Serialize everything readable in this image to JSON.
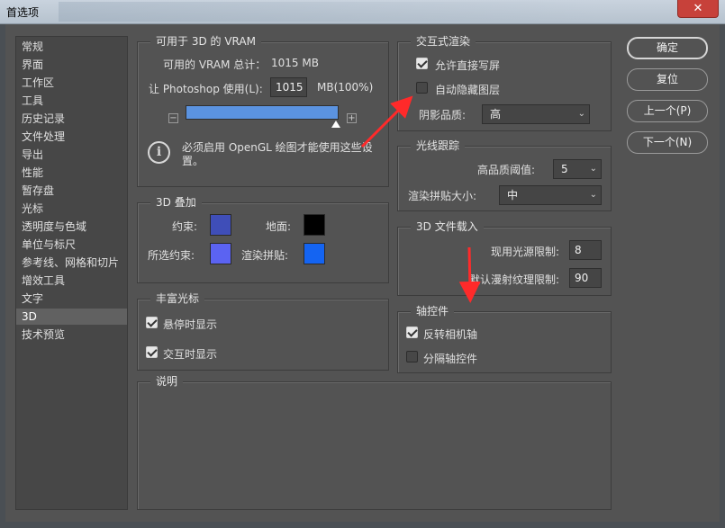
{
  "window": {
    "title": "首选项",
    "close_glyph": "✕"
  },
  "sidebar": {
    "items": [
      {
        "label": "常规"
      },
      {
        "label": "界面"
      },
      {
        "label": "工作区"
      },
      {
        "label": "工具"
      },
      {
        "label": "历史记录"
      },
      {
        "label": "文件处理"
      },
      {
        "label": "导出"
      },
      {
        "label": "性能"
      },
      {
        "label": "暂存盘"
      },
      {
        "label": "光标"
      },
      {
        "label": "透明度与色域"
      },
      {
        "label": "单位与标尺"
      },
      {
        "label": "参考线、网格和切片"
      },
      {
        "label": "增效工具"
      },
      {
        "label": "文字"
      },
      {
        "label": "3D"
      },
      {
        "label": "技术预览"
      }
    ],
    "active_index": 15
  },
  "vram": {
    "title": "可用于 3D 的 VRAM",
    "total_label": "可用的 VRAM 总计：",
    "total_value": "1015 MB",
    "use_label": "让 Photoshop 使用(L):",
    "use_value": "1015",
    "use_suffix": "MB(100%)",
    "slider_fraction": 1.0,
    "minus_icon": "minus-icon",
    "plus_icon": "plus-icon",
    "minus_glyph": "−",
    "plus_glyph": "+",
    "info_glyph": "i",
    "note": "必须启用 OpenGL 绘图才能使用这些设置。"
  },
  "overlay": {
    "title": "3D 叠加",
    "constraint_label": "约束:",
    "constraint_color": "#3f4eb8",
    "ground_label": "地面:",
    "ground_color": "#000000",
    "selected_label": "所选约束:",
    "selected_color": "#5b63f2",
    "render_tile_label": "渲染拼贴:",
    "render_tile_color": "#1464f2"
  },
  "rich_cursor": {
    "title": "丰富光标",
    "hover_label": "悬停时显示",
    "hover_checked": true,
    "interact_label": "交互时显示",
    "interact_checked": true
  },
  "description": {
    "title": "说明"
  },
  "interactive_render": {
    "title": "交互式渲染",
    "direct_write_label": "允许直接写屏",
    "direct_write_checked": true,
    "auto_hide_label": "自动隐藏图层",
    "auto_hide_checked": false,
    "shadow_quality_label": "阴影品质:",
    "shadow_quality_value": "高"
  },
  "ray_tracing": {
    "title": "光线跟踪",
    "threshold_label": "高品质阈值:",
    "threshold_value": "5",
    "tile_size_label": "渲染拼贴大小:",
    "tile_size_value": "中"
  },
  "file_load": {
    "title": "3D 文件载入",
    "light_limit_label": "现用光源限制:",
    "light_limit_value": "8",
    "diffuse_limit_label": "默认漫射纹理限制:",
    "diffuse_limit_value": "90"
  },
  "axis_widget": {
    "title": "轴控件",
    "invert_label": "反转相机轴",
    "invert_checked": true,
    "separate_label": "分隔轴控件",
    "separate_checked": false
  },
  "buttons": {
    "ok": "确定",
    "reset": "复位",
    "prev": "上一个(P)",
    "next": "下一个(N)"
  },
  "annotations": {
    "arrow_color": "#ff2a2a"
  },
  "chevron_glyph": "⌄"
}
